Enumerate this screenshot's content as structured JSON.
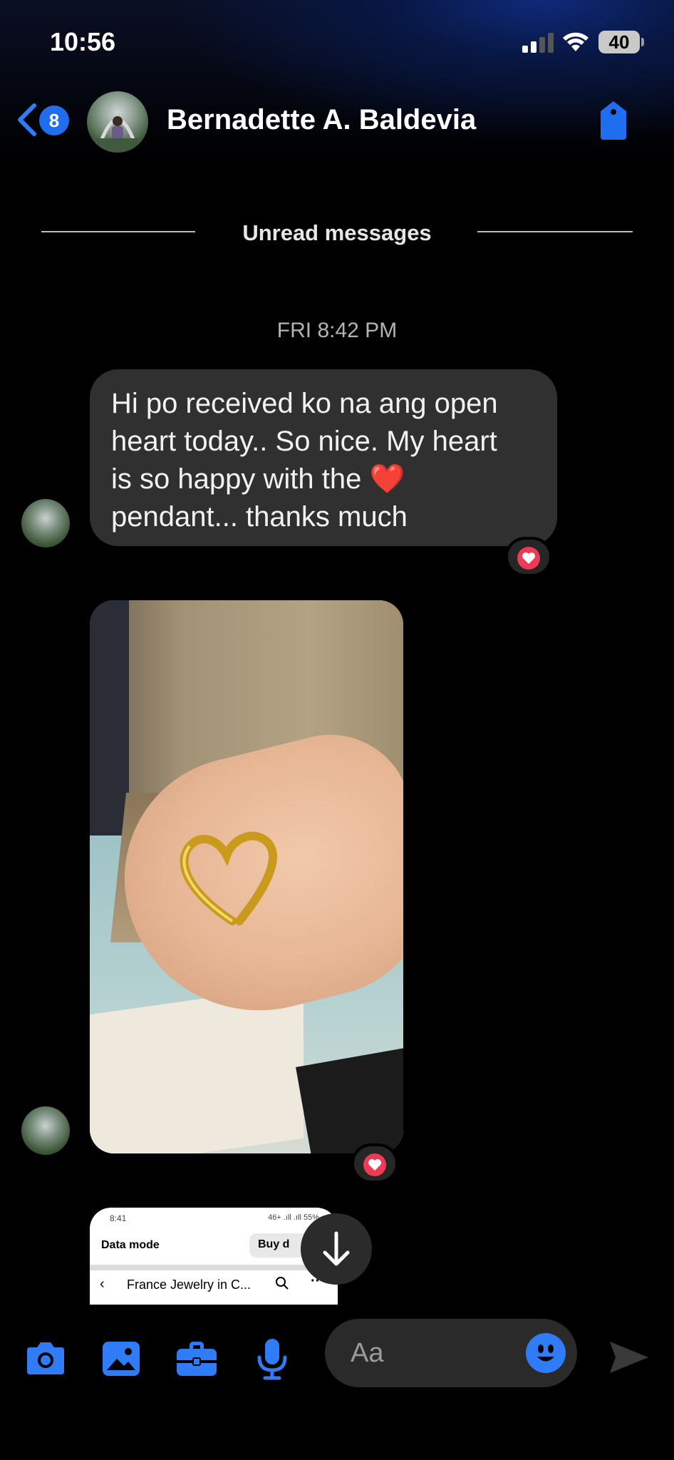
{
  "status_bar": {
    "time": "10:56",
    "battery": "40"
  },
  "header": {
    "back_badge": "8",
    "contact_name": "Bernadette A. Baldevia"
  },
  "thread": {
    "unread_label": "Unread messages",
    "timestamp": "FRI 8:42 PM",
    "message_lines": [
      "Hi po received ko na ang open",
      "heart today.. So nice. My heart",
      "is so happy with the",
      "pendant... thanks much"
    ],
    "message_emoji": "❤️",
    "reaction": "heart"
  },
  "preview": {
    "status_time": "8:41",
    "status_right": "46+ .ıll .ıll 55%",
    "data_mode": "Data mode",
    "buy_label": "Buy d",
    "page_title": "France Jewelry in C...",
    "more": "···"
  },
  "composer": {
    "placeholder": "Aa"
  },
  "colors": {
    "accent": "#1f6ef0",
    "bubble": "#303030",
    "reaction": "#ee3b55"
  }
}
